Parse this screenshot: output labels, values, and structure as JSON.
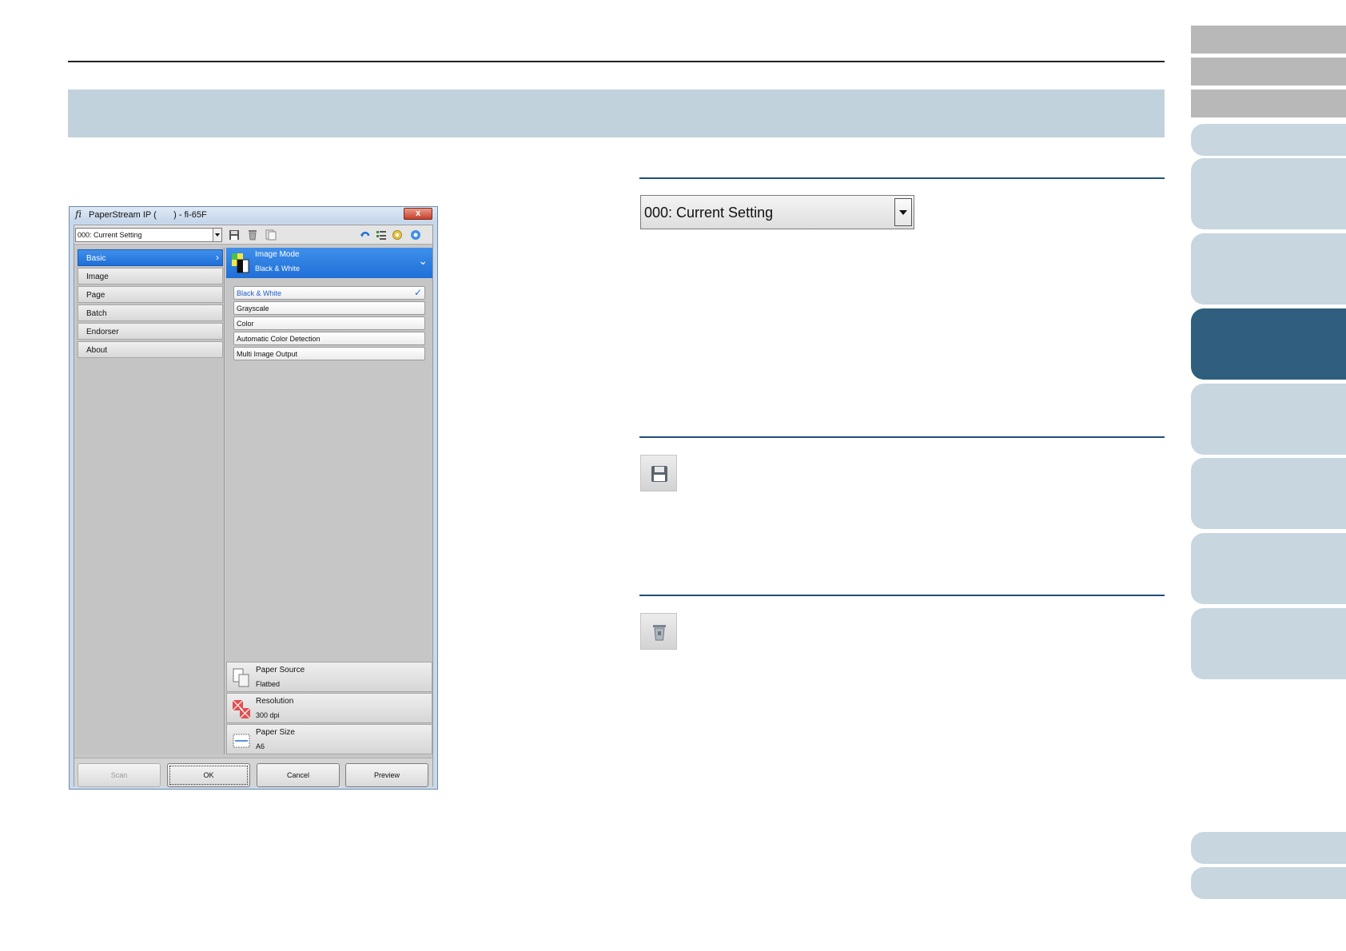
{
  "dialog": {
    "logo": "fi",
    "title": "PaperStream IP (       ) - fi-65F",
    "close_glyph": "x",
    "profile_combo": "000: Current Setting",
    "nav": [
      {
        "label": "Basic",
        "selected": true
      },
      {
        "label": "Image"
      },
      {
        "label": "Page"
      },
      {
        "label": "Batch"
      },
      {
        "label": "Endorser"
      },
      {
        "label": "About"
      }
    ],
    "image_mode": {
      "title": "Image Mode",
      "value": "Black & White"
    },
    "options": [
      "Black & White",
      "Grayscale",
      "Color",
      "Automatic Color Detection",
      "Multi Image Output"
    ],
    "selected_option": "Black & White",
    "summaries": [
      {
        "title": "Paper Source",
        "value": "Flatbed"
      },
      {
        "title": "Resolution",
        "value": "300 dpi"
      },
      {
        "title": "Paper Size",
        "value": "A6"
      }
    ],
    "buttons": {
      "scan": "Scan",
      "ok": "OK",
      "cancel": "Cancel",
      "preview": "Preview"
    }
  },
  "right": {
    "combo": "000: Current Setting"
  },
  "colors": {
    "title_band": "#c2d2dc",
    "active_tab": "#2f5e7e",
    "light_tab": "#c7d6df",
    "gray_tab": "#b8b8b8",
    "rule_blue": "#1f4e79",
    "selection_blue": "#1f6fd8"
  },
  "icons": [
    "save-icon",
    "delete-icon",
    "check-icon",
    "chevron-right-icon",
    "chevron-down-icon",
    "close-icon"
  ]
}
